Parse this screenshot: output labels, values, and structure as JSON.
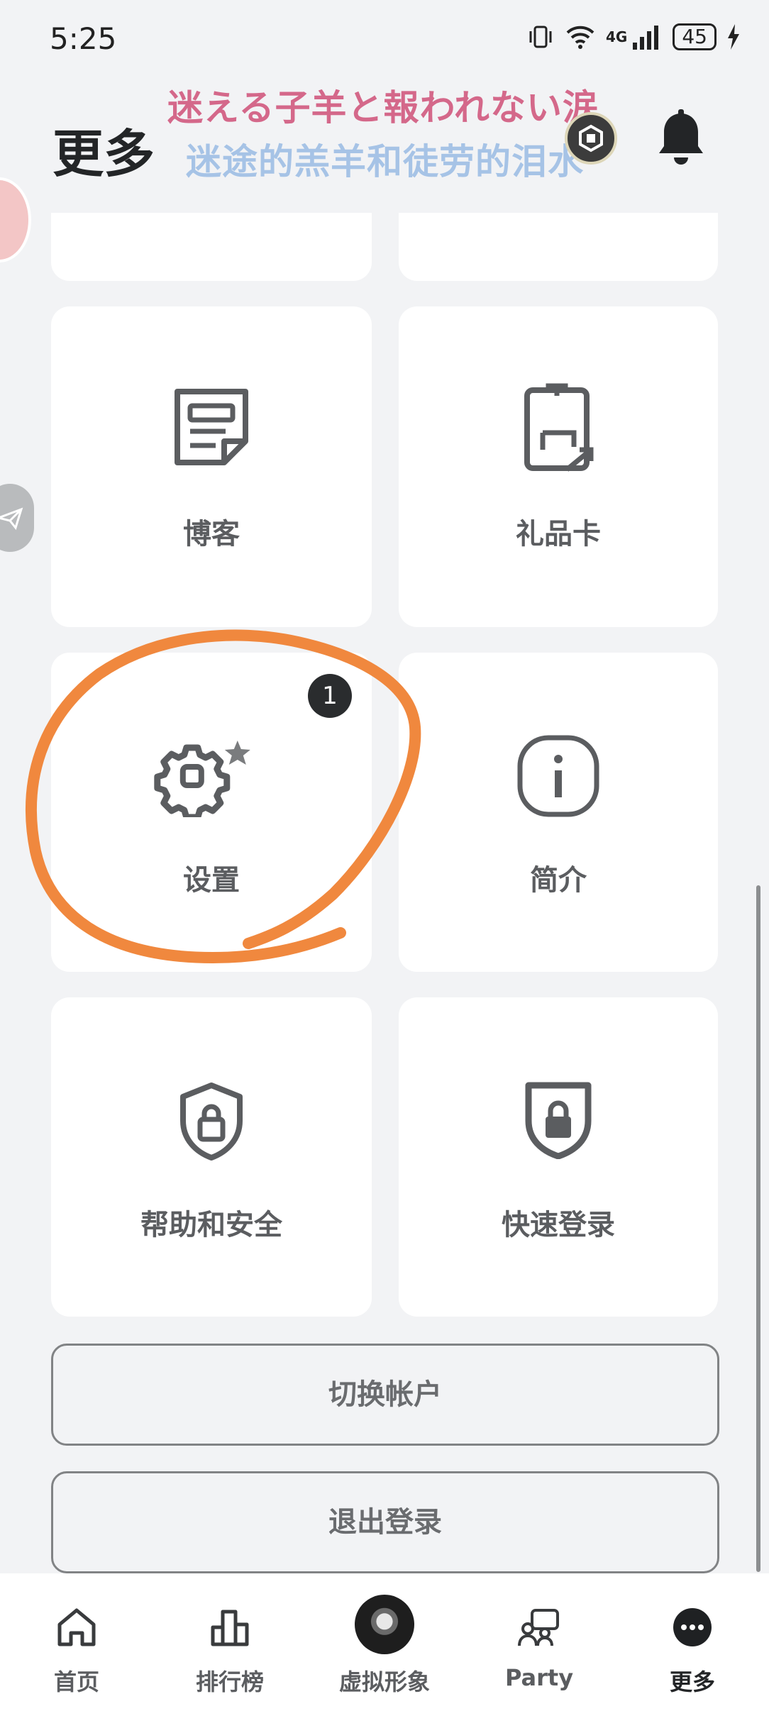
{
  "status_bar": {
    "time": "5:25",
    "network": "4G",
    "battery": "45"
  },
  "header": {
    "title": "更多",
    "overlay_jp": "迷える子羊と報われない涙",
    "overlay_cn": "迷途的羔羊和徒劳的泪水"
  },
  "tiles": {
    "blog": "博客",
    "gift_card": "礼品卡",
    "settings": "设置",
    "settings_badge": "1",
    "about": "简介",
    "help_safety": "帮助和安全",
    "quick_login": "快速登录"
  },
  "buttons": {
    "switch_account": "切换帐户",
    "logout": "退出登录"
  },
  "bottom_nav": {
    "home": "首页",
    "charts": "排行榜",
    "avatar": "虚拟形象",
    "party": "Party",
    "more": "更多"
  },
  "colors": {
    "background": "#f2f3f5",
    "tile": "#ffffff",
    "annotation_circle": "#f0883e",
    "overlay_jp": "#d4688a",
    "overlay_cn": "#a6c3e6"
  }
}
